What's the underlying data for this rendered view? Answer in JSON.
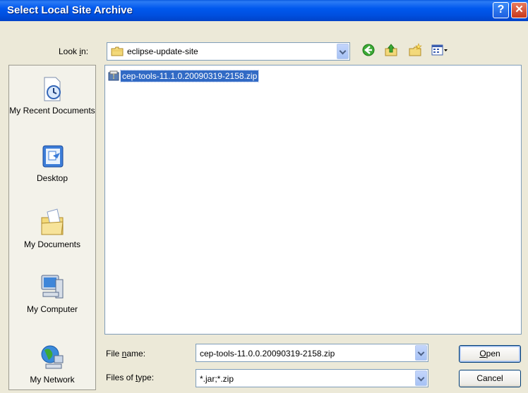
{
  "window": {
    "title": "Select Local Site Archive",
    "help_label": "?",
    "close_label": "✕"
  },
  "look_in": {
    "label_pre": "Look ",
    "label_accel": "i",
    "label_post": "n:",
    "value": "eclipse-update-site",
    "icon": "folder-icon"
  },
  "toolbar": {
    "back_icon": "back-icon",
    "up_icon": "up-folder-icon",
    "new_folder_icon": "new-folder-icon",
    "views_icon": "views-menu-icon"
  },
  "places": [
    {
      "label": "My Recent Documents",
      "icon": "recent-documents-icon"
    },
    {
      "label": "Desktop",
      "icon": "desktop-icon"
    },
    {
      "label": "My Documents",
      "icon": "my-documents-icon"
    },
    {
      "label": "My Computer",
      "icon": "my-computer-icon"
    },
    {
      "label": "My Network",
      "icon": "my-network-icon"
    }
  ],
  "files": [
    {
      "name": "cep-tools-11.1.0.20090319-2158.zip",
      "selected": true,
      "icon": "zip-file-icon"
    }
  ],
  "file_name": {
    "label_pre": "File ",
    "label_accel": "n",
    "label_post": "ame:",
    "value": "cep-tools-11.0.0.20090319-2158.zip"
  },
  "file_type": {
    "label_pre": "Files of ",
    "label_accel": "t",
    "label_post": "ype:",
    "value": "*.jar;*.zip"
  },
  "buttons": {
    "open_accel": "O",
    "open_rest": "pen",
    "cancel": "Cancel"
  },
  "colors": {
    "title_blue": "#0054E3",
    "dialog_bg": "#ECE9D8",
    "selection": "#316AC5"
  }
}
